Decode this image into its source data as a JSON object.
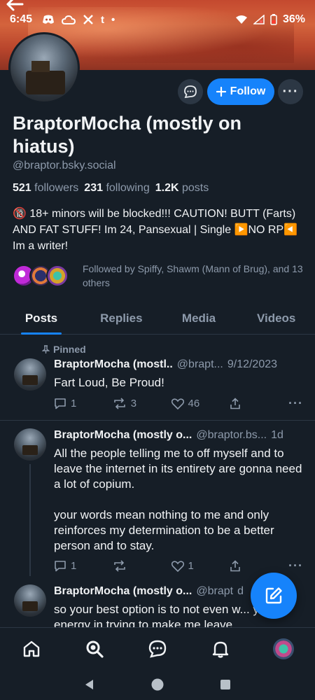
{
  "status_bar": {
    "time": "6:45",
    "icons": [
      "discord-icon",
      "cloud-icon",
      "x-icon",
      "tumblr-icon",
      "dot-icon"
    ],
    "tumblr": "t",
    "battery": "36%"
  },
  "profile": {
    "display_name": "BraptorMocha (mostly on hiatus)",
    "handle": "@braptor.bsky.social",
    "followers_count": "521",
    "followers_label": "followers",
    "following_count": "231",
    "following_label": "following",
    "posts_count": "1.2K",
    "posts_label": "posts",
    "bio": "🔞 18+ minors will be blocked!!! CAUTION! BUTT (Farts) AND FAT STUFF! Im 24, Pansexual | Single ▶️NO RP◀️ Im a writer!",
    "followed_by": "Followed by Spiffy, Shawm (Mann of Brug), and 13 others",
    "follow_label": "Follow"
  },
  "tabs": [
    {
      "label": "Posts",
      "active": true
    },
    {
      "label": "Replies",
      "active": false
    },
    {
      "label": "Media",
      "active": false
    },
    {
      "label": "Videos",
      "active": false
    }
  ],
  "posts": [
    {
      "pinned_label": "Pinned",
      "name": "BraptorMocha (mostl..",
      "handle": "@brapt...",
      "date": "9/12/2023",
      "text": "Fart Loud, Be Proud!",
      "replies": "1",
      "reposts": "3",
      "likes": "46"
    },
    {
      "name": "BraptorMocha (mostly o...",
      "handle": "@braptor.bs...",
      "date": "1d",
      "text_p1": "All the people telling me to off myself and to leave the internet in its entirety are gonna need a lot of copium.",
      "text_p2": "your words mean nothing to me and only reinforces my determination to be a better person and to stay.",
      "replies": "1",
      "reposts": "",
      "likes": "1"
    },
    {
      "name": "BraptorMocha (mostly o...",
      "handle": "@brapt",
      "date": "d",
      "text": "so your best option is to not even w... your energy in trying to make me leave."
    }
  ],
  "colors": {
    "accent": "#1683fb",
    "background": "#161e27",
    "muted_text": "#8d9aab"
  }
}
